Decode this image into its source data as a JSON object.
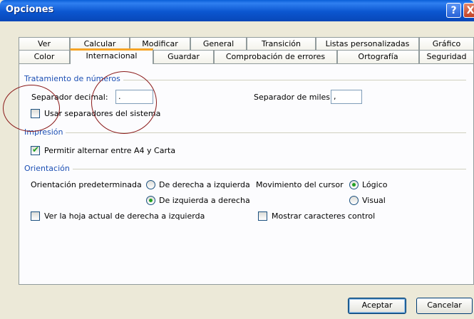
{
  "window": {
    "title": "Opciones",
    "help_label": "?",
    "close_label": "X"
  },
  "tabs": {
    "row1": [
      "Ver",
      "Calcular",
      "Modificar",
      "General",
      "Transición",
      "Listas personalizadas",
      "Gráfico"
    ],
    "row2": [
      "Color",
      "Internacional",
      "Guardar",
      "Comprobación de errores",
      "Ortografía",
      "Seguridad"
    ],
    "active": "Internacional"
  },
  "numbers": {
    "title": "Tratamiento de números",
    "decimal_label": "Separador decimal:",
    "decimal_value": ".",
    "thousands_label": "Separador de miles:",
    "thousands_value": ",",
    "use_system_label": "Usar separadores del sistema",
    "use_system_checked": false
  },
  "printing": {
    "title": "Impresión",
    "allow_a4_label": "Permitir alternar entre A4 y Carta",
    "allow_a4_checked": true
  },
  "orientation": {
    "title": "Orientación",
    "default_label": "Orientación predeterminada",
    "rtl_label": "De derecha a izquierda",
    "ltr_label": "De izquierda a derecha",
    "cursor_label": "Movimiento del cursor",
    "logical_label": "Lógico",
    "visual_label": "Visual",
    "sheet_rtl_label": "Ver la hoja actual de derecha a izquierda",
    "show_control_label": "Mostrar caracteres control"
  },
  "buttons": {
    "ok": "Aceptar",
    "cancel": "Cancelar"
  },
  "colors": {
    "accent": "#1c4fb4",
    "check": "#21a121",
    "annotation": "#8b1a1a",
    "titlebar": "#0b56d0"
  }
}
